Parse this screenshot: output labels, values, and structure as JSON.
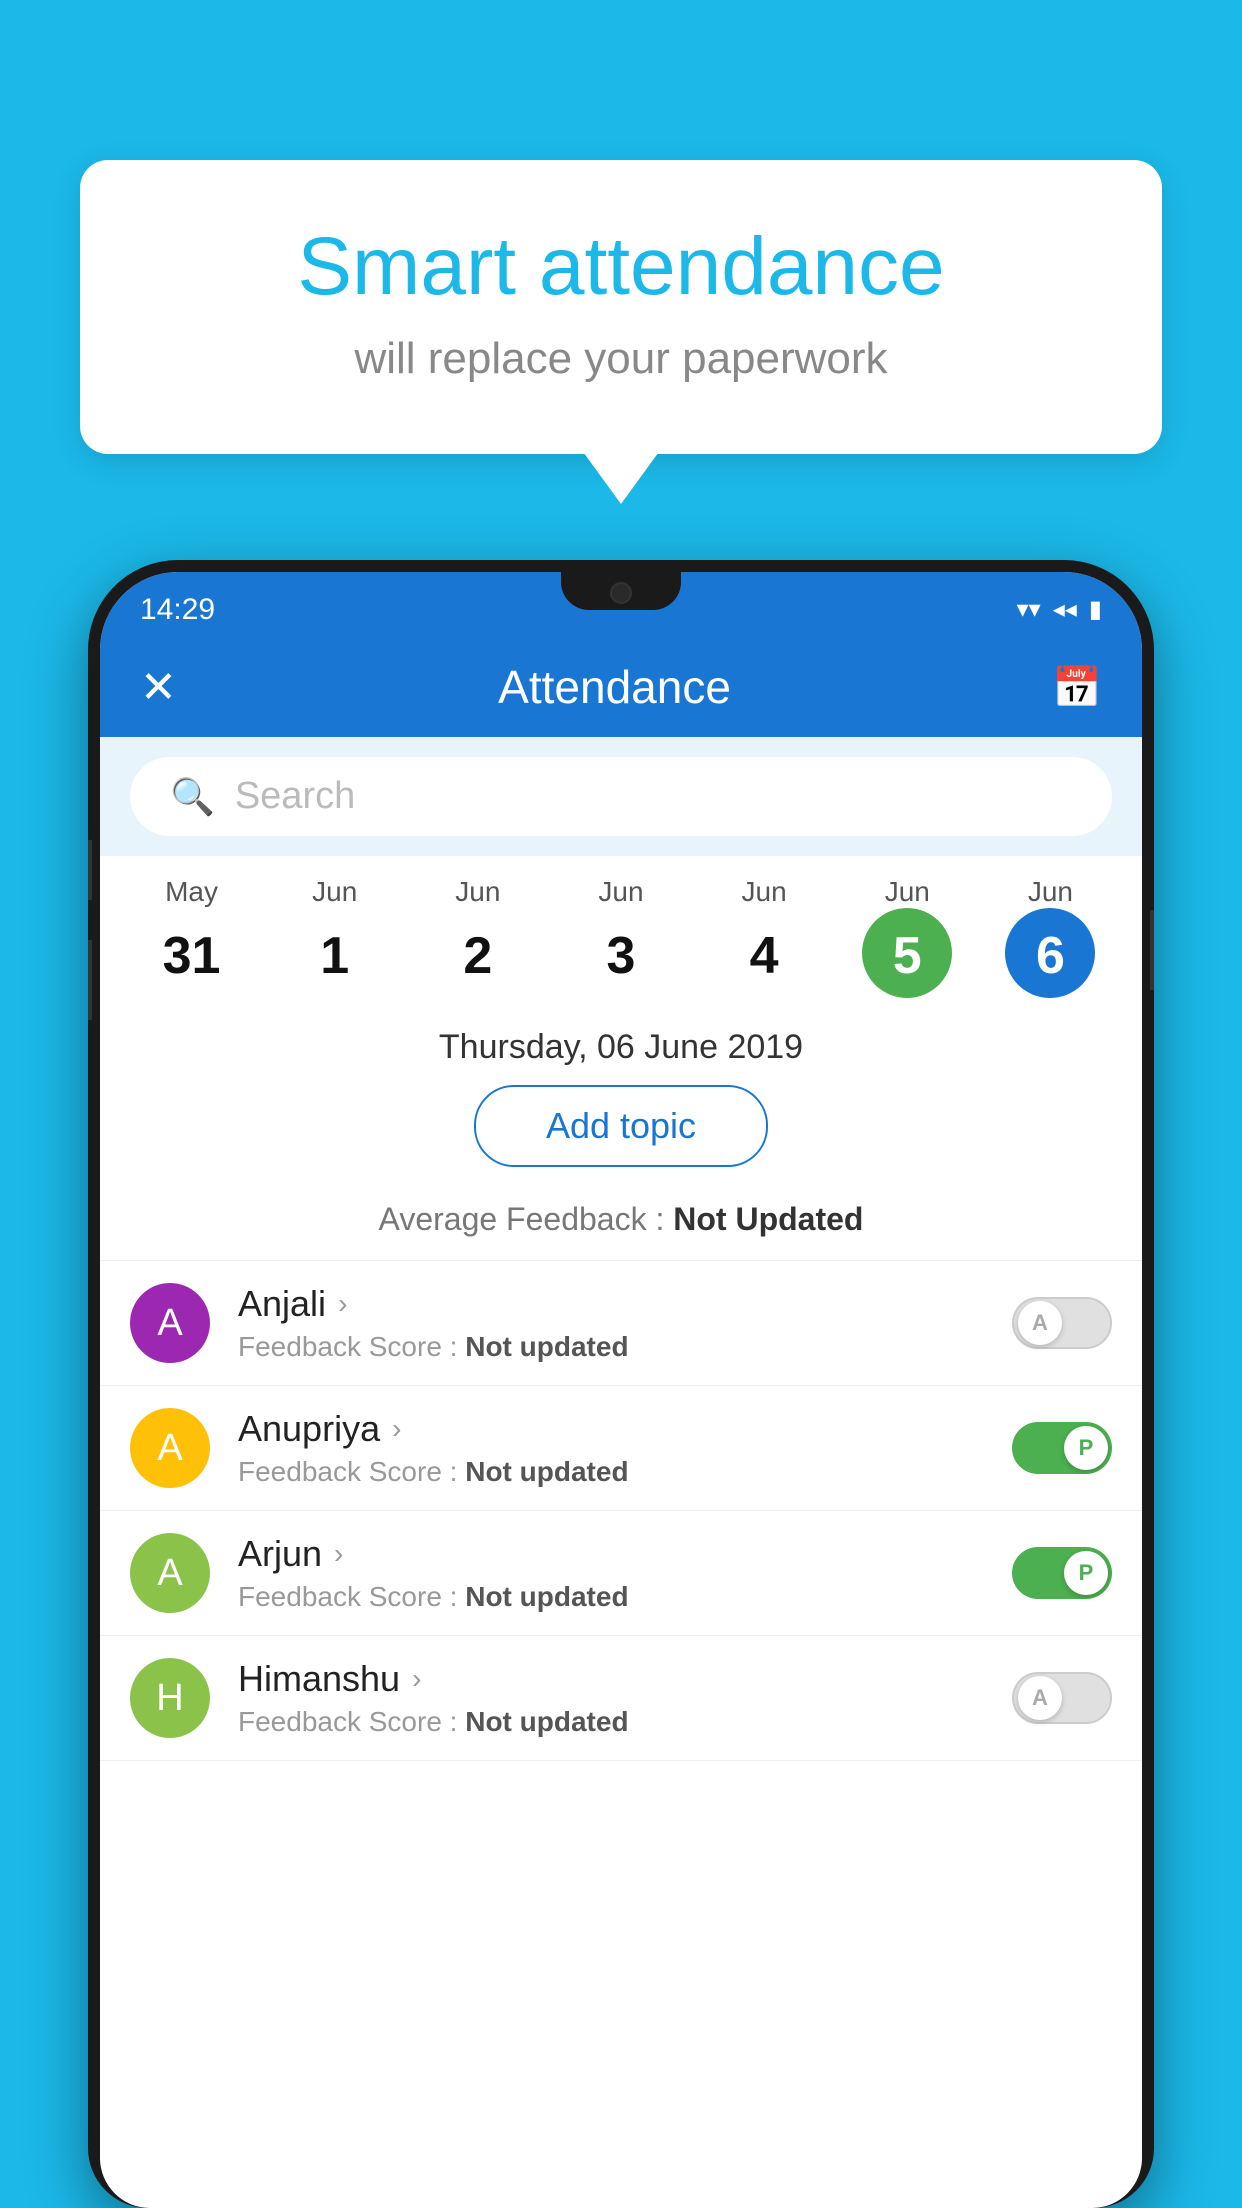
{
  "background_color": "#1BB8E8",
  "bubble": {
    "title": "Smart attendance",
    "subtitle": "will replace your paperwork"
  },
  "status_bar": {
    "time": "14:29",
    "wifi_icon": "▼",
    "signal_icon": "▲",
    "battery_icon": "▮"
  },
  "header": {
    "title": "Attendance",
    "close_label": "✕",
    "calendar_icon": "📅"
  },
  "search": {
    "placeholder": "Search"
  },
  "dates": [
    {
      "month": "May",
      "day": "31",
      "state": "normal"
    },
    {
      "month": "Jun",
      "day": "1",
      "state": "normal"
    },
    {
      "month": "Jun",
      "day": "2",
      "state": "normal"
    },
    {
      "month": "Jun",
      "day": "3",
      "state": "normal"
    },
    {
      "month": "Jun",
      "day": "4",
      "state": "normal"
    },
    {
      "month": "Jun",
      "day": "5",
      "state": "today"
    },
    {
      "month": "Jun",
      "day": "6",
      "state": "selected"
    }
  ],
  "selected_date_label": "Thursday, 06 June 2019",
  "add_topic_label": "Add topic",
  "avg_feedback": {
    "label": "Average Feedback : ",
    "value": "Not Updated"
  },
  "students": [
    {
      "name": "Anjali",
      "avatar_letter": "A",
      "avatar_color": "#9C27B0",
      "feedback": "Not updated",
      "toggle_state": "off",
      "toggle_label": "A"
    },
    {
      "name": "Anupriya",
      "avatar_letter": "A",
      "avatar_color": "#FFC107",
      "feedback": "Not updated",
      "toggle_state": "on",
      "toggle_label": "P"
    },
    {
      "name": "Arjun",
      "avatar_letter": "A",
      "avatar_color": "#8BC34A",
      "feedback": "Not updated",
      "toggle_state": "on",
      "toggle_label": "P"
    },
    {
      "name": "Himanshu",
      "avatar_letter": "H",
      "avatar_color": "#8BC34A",
      "feedback": "Not updated",
      "toggle_state": "off",
      "toggle_label": "A"
    }
  ],
  "feedback_score_label": "Feedback Score : "
}
